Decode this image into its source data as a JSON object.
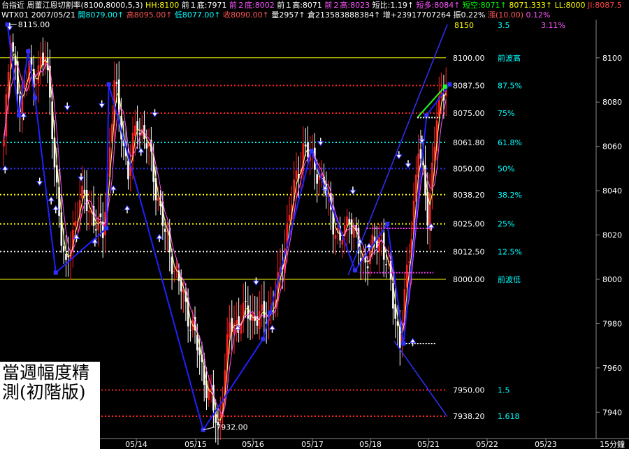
{
  "header1": [
    {
      "text": "台指近 周董江恩切割率(8100,8000,5,3)",
      "color": "#ffffff"
    },
    {
      "text": " HH:8100",
      "color": "#ffff00"
    },
    {
      "text": " 前１底:7971",
      "color": "#ffffff"
    },
    {
      "text": " 前２底:8002",
      "color": "#ff55ff"
    },
    {
      "text": " 前１高:8071",
      "color": "#ffffff"
    },
    {
      "text": " 前２高:8023",
      "color": "#ff55ff"
    },
    {
      "text": " 短比:1.19↑",
      "color": "#ffffff"
    },
    {
      "text": " 短多:8084↑",
      "color": "#ff55ff"
    },
    {
      "text": " 短空:8071↑",
      "color": "#00ff00"
    },
    {
      "text": " 8071.333↑",
      "color": "#ffff00"
    },
    {
      "text": " LL:8000",
      "color": "#ffff00"
    },
    {
      "text": " JI:8087.5",
      "color": "#ff4444"
    }
  ],
  "header2": [
    {
      "text": "WTX01 2007/05/21",
      "color": "#ffffff"
    },
    {
      "text": " 開8079.00↑",
      "color": "#00ffff"
    },
    {
      "text": " 高8095.00↑",
      "color": "#ff5555"
    },
    {
      "text": " 低8077.00↑",
      "color": "#00ffff"
    },
    {
      "text": " 收8090.00↑",
      "color": "#ff5555"
    },
    {
      "text": " 量2957↑",
      "color": "#ffffff"
    },
    {
      "text": " 倉213583888384↑",
      "color": "#ffffff"
    },
    {
      "text": " 增+23917707264",
      "color": "#ffffff"
    },
    {
      "text": " 振0.22%",
      "color": "#ffffff"
    },
    {
      "text": " 漲(10.00)",
      "color": "#ff5555"
    },
    {
      "text": " 0.12%",
      "color": "#ff55ff"
    }
  ],
  "note": {
    "line1": "當週幅度精",
    "line2": "測(初階版)"
  },
  "timeframe": "15分鐘",
  "chart_data": {
    "type": "candlestick",
    "ylim": [
      7930,
      8116
    ],
    "y_ticks": [
      7940,
      7960,
      7980,
      8000,
      8020,
      8040,
      8060,
      8080,
      8100
    ],
    "x_ticks": [
      "05/14",
      "05/15",
      "05/16",
      "05/17",
      "05/18",
      "05/21",
      "05/22",
      "05/23"
    ],
    "top_labels": [
      {
        "text": "8150",
        "color": "#ffff00"
      },
      {
        "text": "3.5",
        "color": "#00ffff"
      },
      {
        "text": "3.11%",
        "color": "#ff55ff"
      }
    ],
    "levels": [
      {
        "value": 8100.0,
        "label": "8100.00",
        "ratio": "前波高",
        "color": "#ffff00",
        "style": "solid"
      },
      {
        "value": 8087.5,
        "label": "8087.50",
        "ratio": "87.5%",
        "color": "#ff2020",
        "style": "dot"
      },
      {
        "value": 8075.0,
        "label": "8075.00",
        "ratio": "75%",
        "color": "#ff2020",
        "style": "dot"
      },
      {
        "value": 8061.8,
        "label": "8061.80",
        "ratio": "61.8%",
        "color": "#00ffff",
        "style": "dot"
      },
      {
        "value": 8050.0,
        "label": "8050.00",
        "ratio": "50%",
        "color": "#3030ff",
        "style": "dot"
      },
      {
        "value": 8038.2,
        "label": "8038.20",
        "ratio": "38.2%",
        "color": "#ffff00",
        "style": "dot"
      },
      {
        "value": 8025.0,
        "label": "8025.00",
        "ratio": "25%",
        "color": "#ffff00",
        "style": "dot"
      },
      {
        "value": 8012.5,
        "label": "8012.50",
        "ratio": "12.5%",
        "color": "#ffffff",
        "style": "dot"
      },
      {
        "value": 8000.0,
        "label": "8000.00",
        "ratio": "前波低",
        "color": "#ffff00",
        "style": "solid"
      },
      {
        "value": 7950.0,
        "label": "7950.00",
        "ratio": "1.5",
        "color": "#ff2020",
        "style": "dot"
      },
      {
        "value": 7938.2,
        "label": "7938.20",
        "ratio": "1.618",
        "color": "#ff2020",
        "style": "dot"
      }
    ],
    "annotations": [
      {
        "text": "8115.00",
        "value": 8115
      },
      {
        "text": "7932.00",
        "value": 7932
      }
    ],
    "swing_points": [
      [
        0,
        8060
      ],
      [
        3,
        8113
      ],
      [
        7,
        8075
      ],
      [
        11,
        8102
      ],
      [
        13,
        8085
      ],
      [
        18,
        8106
      ],
      [
        22,
        8050
      ],
      [
        27,
        8003
      ],
      [
        33,
        8038
      ],
      [
        38,
        8030
      ],
      [
        43,
        8020
      ],
      [
        48,
        8088
      ],
      [
        54,
        8048
      ],
      [
        58,
        8072
      ],
      [
        63,
        8058
      ],
      [
        70,
        8020
      ],
      [
        77,
        7995
      ],
      [
        82,
        7978
      ],
      [
        86,
        7960
      ],
      [
        90,
        7945
      ],
      [
        93,
        7932
      ],
      [
        98,
        7978
      ],
      [
        105,
        7985
      ],
      [
        112,
        7982
      ],
      [
        118,
        7990
      ],
      [
        124,
        8030
      ],
      [
        130,
        8060
      ],
      [
        136,
        8050
      ],
      [
        141,
        8035
      ],
      [
        146,
        8015
      ],
      [
        150,
        8030
      ],
      [
        155,
        8008
      ],
      [
        159,
        8012
      ],
      [
        164,
        8020
      ],
      [
        169,
        7990
      ],
      [
        172,
        7972
      ],
      [
        176,
        8010
      ],
      [
        180,
        8060
      ],
      [
        184,
        8030
      ],
      [
        188,
        8072
      ],
      [
        192,
        8091
      ]
    ],
    "zigzag": [
      [
        2,
        8115
      ],
      [
        7,
        8074
      ],
      [
        11,
        8103
      ],
      [
        14,
        8082
      ],
      [
        23,
        8003
      ],
      [
        45,
        8023
      ],
      [
        46,
        8088
      ],
      [
        87,
        7932
      ],
      [
        113,
        7973
      ],
      [
        116,
        7985
      ],
      [
        134,
        8058
      ],
      [
        153,
        8004
      ],
      [
        167,
        8025
      ],
      [
        174,
        7971
      ],
      [
        184,
        8074
      ],
      [
        194,
        8088
      ]
    ],
    "green_segment": [
      [
        180,
        8073
      ],
      [
        192,
        8087
      ]
    ],
    "white_dashes": [
      {
        "x0": 180,
        "x1": 190,
        "value": 8073
      },
      {
        "x0": 175,
        "x1": 188,
        "value": 7971
      }
    ],
    "magenta_dashes": [
      {
        "x0": 158,
        "x1": 187,
        "value": 8023
      },
      {
        "x0": 155,
        "x1": 187,
        "value": 8003
      }
    ],
    "channel_lines": [
      [
        [
          150,
          8002
        ],
        [
          193,
          8115
        ]
      ],
      [
        [
          170,
          7972
        ],
        [
          193,
          7938
        ]
      ]
    ],
    "down_arrows": [
      [
        3,
        8113
      ],
      [
        16,
        8043
      ],
      [
        28,
        8077
      ],
      [
        34,
        8045
      ],
      [
        43,
        8078
      ],
      [
        66,
        8074
      ],
      [
        110,
        7998
      ],
      [
        138,
        8061
      ],
      [
        152,
        8039
      ],
      [
        172,
        8055
      ],
      [
        176,
        8051
      ],
      [
        182,
        8062
      ]
    ],
    "up_arrows": [
      [
        1,
        8050
      ],
      [
        9,
        8074
      ],
      [
        21,
        8036
      ],
      [
        23,
        8032
      ],
      [
        32,
        8019
      ],
      [
        40,
        8017
      ],
      [
        48,
        8041
      ],
      [
        54,
        8032
      ],
      [
        60,
        8058
      ],
      [
        68,
        8019
      ],
      [
        102,
        7978
      ],
      [
        117,
        7978
      ],
      [
        140,
        8041
      ],
      [
        155,
        8017
      ],
      [
        159,
        8015
      ],
      [
        178,
        7972
      ],
      [
        186,
        8024
      ]
    ],
    "bars": 193
  }
}
